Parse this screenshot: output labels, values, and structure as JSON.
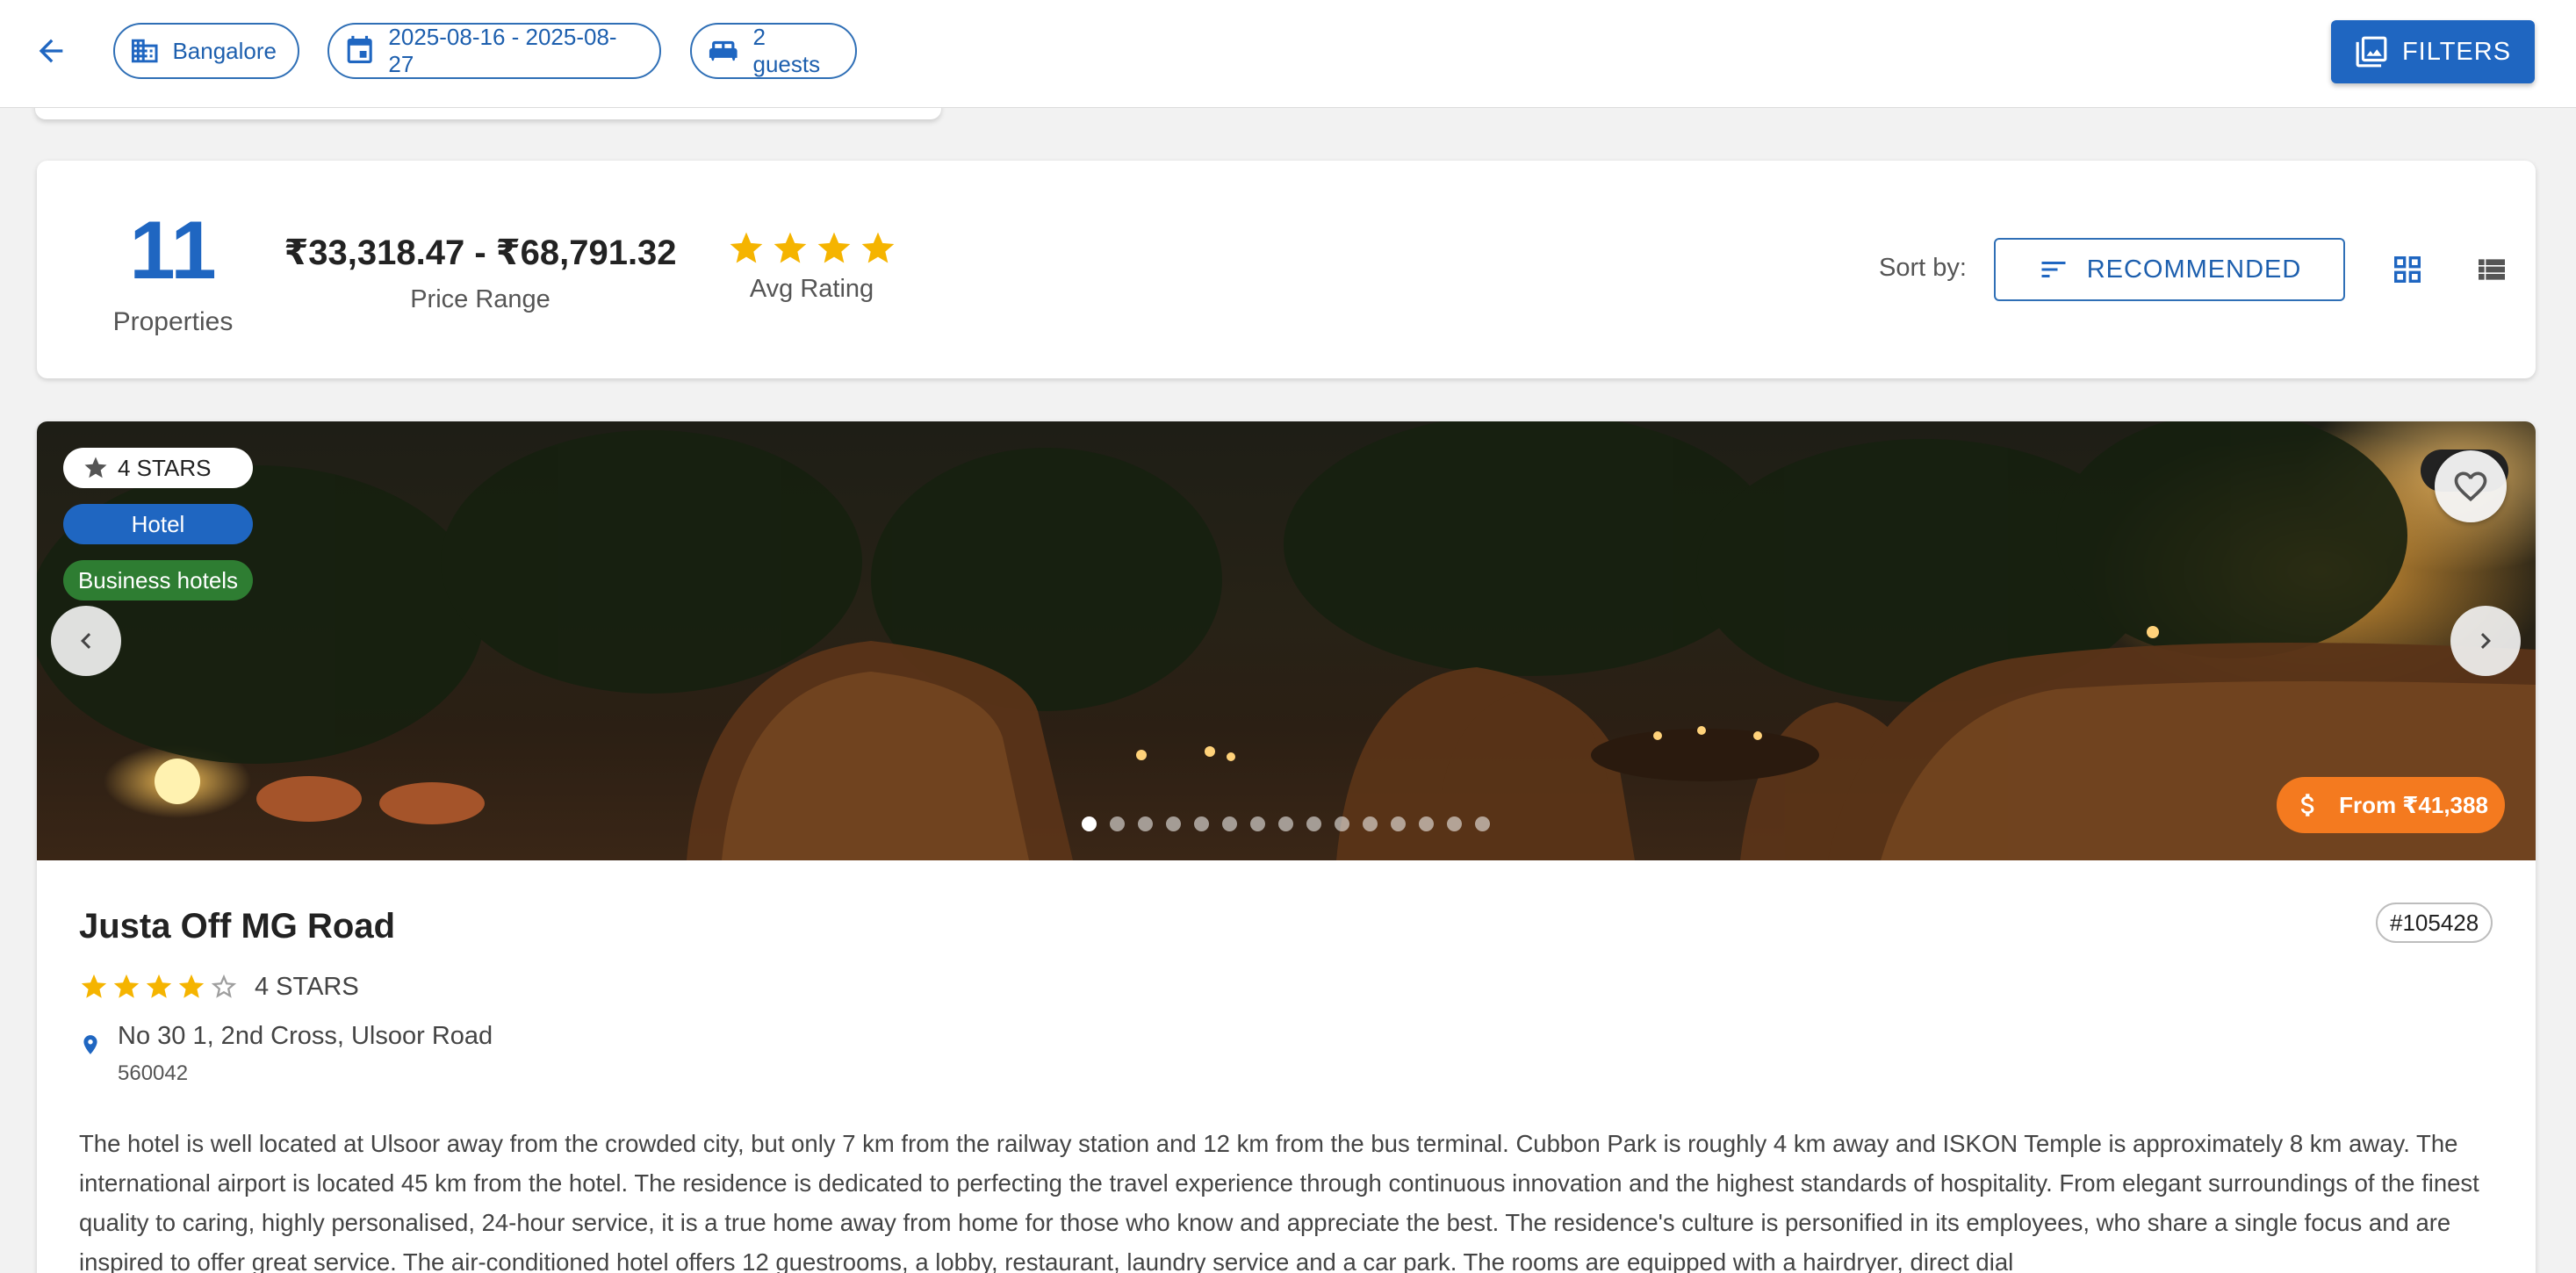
{
  "topbar": {
    "chips": {
      "city": "Bangalore",
      "dates": "2025-08-16 - 2025-08-27",
      "guests": "2 guests"
    },
    "filters_label": "FILTERS"
  },
  "summary": {
    "count": "11",
    "count_label": "Properties",
    "price_range": "₹33,318.47 - ₹68,791.32",
    "price_label": "Price Range",
    "avg_rating_stars": 4,
    "avg_label": "Avg Rating",
    "sort_label": "Sort by:",
    "sort_value": "RECOMMENDED"
  },
  "hotel": {
    "badges": {
      "stars": "4 STARS",
      "type": "Hotel",
      "category": "Business hotels"
    },
    "price_badge": "From ₹41,388",
    "photo_count": 15,
    "active_photo": 1,
    "name": "Justa Off MG Road",
    "id": "#105428",
    "rating": 4,
    "rating_text": "4 STARS",
    "address_line": "No 30 1, 2nd Cross, Ulsoor Road",
    "postal_code": "560042",
    "description": "The hotel is well located at Ulsoor away from the crowded city, but only 7 km from the railway station and 12 km from the bus terminal. Cubbon Park is roughly 4 km away and ISKON Temple is approximately 8 km away. The international airport is located 45 km from the hotel. The residence is dedicated to perfecting the travel experience through continuous innovation and the highest standards of hospitality. From elegant surroundings of the finest quality to caring, highly personalised, 24-hour service, it is a true home away from home for those who know and appreciate the best. The residence's culture is personified in its employees, who share a single focus and are inspired to offer great service. The air-conditioned hotel offers 12 guestrooms, a lobby, restaurant, laundry service and a car park. The rooms are equipped with a hairdryer, direct dial"
  },
  "colors": {
    "primary": "#1f66c1",
    "star": "#f5b400",
    "price_badge": "#f47a1f",
    "category_badge": "#2e7d32"
  }
}
